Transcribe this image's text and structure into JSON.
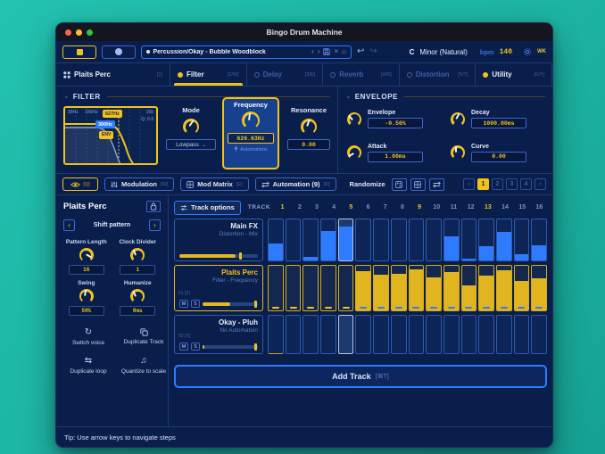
{
  "window": {
    "title": "Bingo Drum Machine"
  },
  "toolbar": {
    "preset_name": "Percussion/Okay - Bubble Woodblock",
    "key_root": "C",
    "scale_name": "Minor (Natural)",
    "bpm_label": "bpm",
    "bpm_value": "140",
    "badge": "WK"
  },
  "tabs": [
    {
      "label": "Plaits Perc",
      "shortcut": "[1]",
      "kind": "instrument",
      "active": false,
      "enabled": true
    },
    {
      "label": "Filter",
      "shortcut": "[2/W]",
      "kind": "fx",
      "dot": "on",
      "active": true,
      "enabled": true
    },
    {
      "label": "Delay",
      "shortcut": "[3/E]",
      "kind": "fx",
      "dot": "off",
      "active": false,
      "enabled": false
    },
    {
      "label": "Reverb",
      "shortcut": "[4/R]",
      "kind": "fx",
      "dot": "off",
      "active": false,
      "enabled": false
    },
    {
      "label": "Distortion",
      "shortcut": "[5/T]",
      "kind": "fx",
      "dot": "off",
      "active": false,
      "enabled": false
    },
    {
      "label": "Utility",
      "shortcut": "[6/Y]",
      "kind": "fx",
      "dot": "on",
      "active": false,
      "enabled": true
    }
  ],
  "filter": {
    "title": "FILTER",
    "graph": {
      "hz_left": "20Hz",
      "hz_mid": "100Hz",
      "hz_right": "15k",
      "q_label": "Q: 0.5",
      "cutoff_badge": "627Hz",
      "mod_badge": "300Hz",
      "env_badge": "ENV"
    },
    "mode": {
      "label": "Mode",
      "value": "Lowpass",
      "angle": 35
    },
    "frequency": {
      "label": "Frequency",
      "value": "626.63Hz",
      "note": "Automations",
      "angle": 8
    },
    "resonance": {
      "label": "Resonance",
      "value": "0.00",
      "angle": 20
    }
  },
  "envelope": {
    "title": "ENVELOPE",
    "params": [
      {
        "label": "Envelope",
        "value": "-0.56%",
        "angle": -40
      },
      {
        "label": "Decay",
        "value": "1000.00ms",
        "angle": 30
      },
      {
        "label": "Attack",
        "value": "1.00ms",
        "angle": -120
      },
      {
        "label": "Curve",
        "value": "0.00",
        "angle": 0
      }
    ]
  },
  "modbar": {
    "view_shortcut": "[Q]",
    "buttons": [
      {
        "label": "Modulation",
        "shortcut": "[W]",
        "icon": "modulation"
      },
      {
        "label": "Mod Matrix",
        "shortcut": "[E]",
        "icon": "matrix"
      },
      {
        "label": "Automation (9)",
        "shortcut": "[R]",
        "icon": "swap"
      }
    ],
    "randomize_label": "Randomize",
    "rand_icons": [
      "dice",
      "matrix",
      "swap"
    ],
    "pages": [
      "1",
      "2",
      "3",
      "4"
    ],
    "active_page": "1"
  },
  "sidebar": {
    "track_name": "Plaits Perc",
    "shift_label": "Shift pattern",
    "knobs": [
      {
        "label": "Pattern Length",
        "value": "16",
        "angle": 120
      },
      {
        "label": "Clock Divider",
        "value": "1",
        "angle": -20
      },
      {
        "label": "Swing",
        "value": "50%",
        "angle": 10
      },
      {
        "label": "Humanize",
        "value": "0ms",
        "angle": -25
      }
    ],
    "actions": [
      {
        "label": "Switch voice",
        "icon": "cycle"
      },
      {
        "label": "Duplicate Track",
        "icon": "copy"
      },
      {
        "label": "Duplicate loop",
        "icon": "loop"
      },
      {
        "label": "Quantize to scale",
        "icon": "note"
      }
    ]
  },
  "sequencer": {
    "track_options_label": "Track options",
    "track_label": "TRACK",
    "steps": 16,
    "accent_steps": [
      1,
      5,
      9,
      13
    ],
    "playhead_step": 5,
    "mute_label": "M",
    "solo_label": "S",
    "rows": [
      {
        "name": "Main FX",
        "param": "Distortion - Mix",
        "selected": false,
        "bar_color": "blue",
        "values": [
          0.42,
          0,
          0.08,
          0.72,
          0.82,
          0,
          0,
          0,
          0,
          0,
          0.58,
          0.04,
          0.34,
          0.7,
          0.16,
          0.38
        ],
        "slider_fill": 0.72,
        "slider_handle": 0.78,
        "has_mute_solo": false
      },
      {
        "name": "Plaits Perc",
        "param": "Filter - Frequency",
        "selected": true,
        "bar_color": "yellow",
        "corner_label": "01 [Z]",
        "values": [
          0,
          0,
          0,
          0,
          0,
          0.88,
          0.8,
          0.83,
          0.92,
          0.74,
          0.87,
          0.57,
          0.78,
          0.9,
          0.66,
          0.72
        ],
        "dashes": [
          "y",
          "y",
          "y",
          "y",
          "y",
          "b",
          "b",
          "b",
          "b",
          "b",
          "b",
          "b",
          "b",
          "b",
          "b",
          "b"
        ],
        "slider_fill": 0.5,
        "slider_handle": 0.97,
        "has_mute_solo": true
      },
      {
        "name": "Okay - Pluh",
        "param": "No Automation",
        "selected": false,
        "bar_color": "blue",
        "corner_label": "02 [X]",
        "values": [
          0,
          0,
          0,
          0,
          0,
          0,
          0,
          0,
          0,
          0,
          0,
          0,
          0,
          0,
          0,
          0
        ],
        "slider_fill": 0.04,
        "slider_handle": 0.97,
        "has_mute_solo": true,
        "accent_first_cell": true
      }
    ],
    "add_track_label": "Add Track",
    "add_track_shortcut": "[⌘T]"
  },
  "footer": {
    "tip": "Tip: Use arrow keys to navigate steps"
  },
  "colors": {
    "accent_yellow": "#F2C21C",
    "accent_blue": "#2E7BFF",
    "window_bg": "#0A1E4C",
    "desktop_teal": "#1DB6A4",
    "bar_blue": "#2E7BFF",
    "bar_yellow": "#E0B51F"
  }
}
